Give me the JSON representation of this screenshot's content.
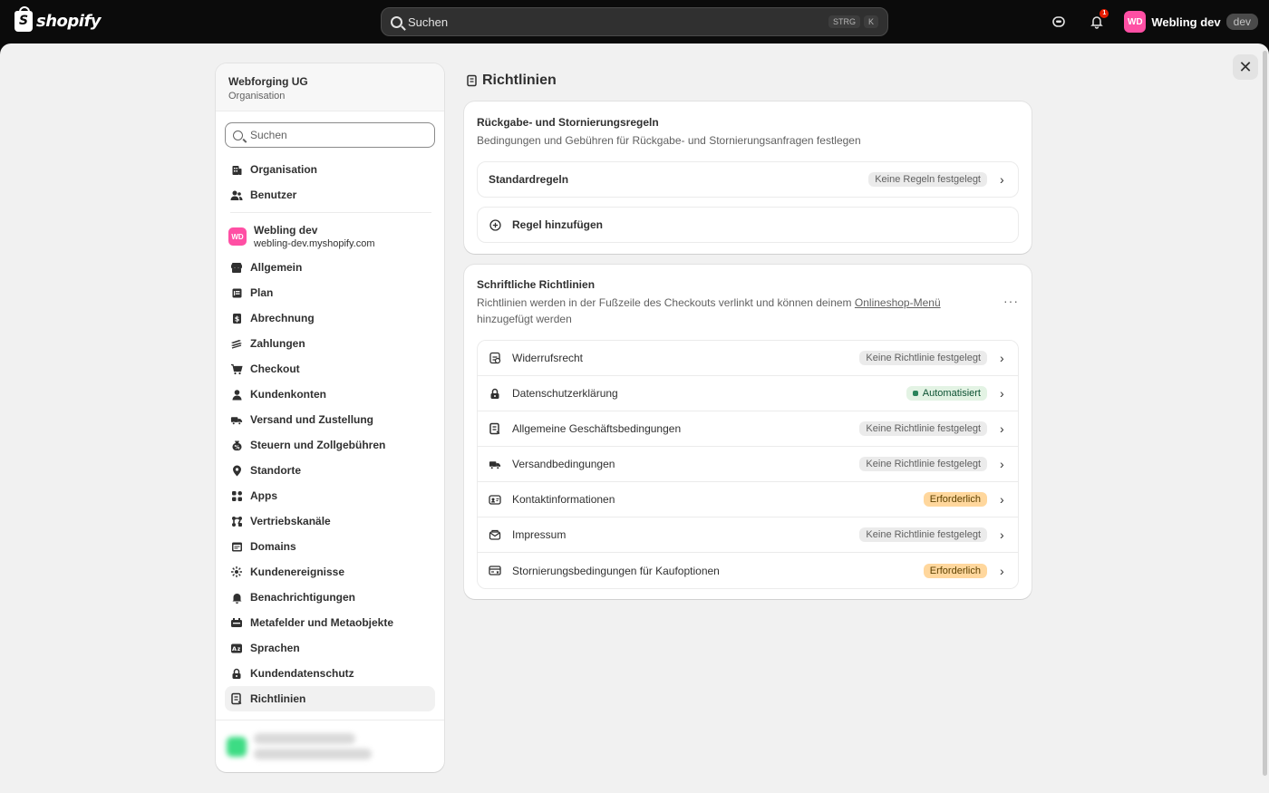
{
  "topbar": {
    "brand": "shopify",
    "search_placeholder": "Suchen",
    "shortcut_1": "STRG",
    "shortcut_2": "K",
    "notification_count": "1",
    "user_initials": "WD",
    "user_name": "Webling dev",
    "env_badge": "dev"
  },
  "sidebar": {
    "org_name": "Webforging UG",
    "org_sub": "Organisation",
    "search_placeholder": "Suchen",
    "org_items": [
      {
        "label": "Organisation",
        "icon": "building-icon"
      },
      {
        "label": "Benutzer",
        "icon": "users-icon"
      }
    ],
    "store_initials": "WD",
    "store_name": "Webling dev",
    "store_url": "webling-dev.myshopify.com",
    "items": [
      {
        "label": "Allgemein",
        "icon": "store-icon"
      },
      {
        "label": "Plan",
        "icon": "plan-icon"
      },
      {
        "label": "Abrechnung",
        "icon": "billing-icon"
      },
      {
        "label": "Zahlungen",
        "icon": "payments-icon"
      },
      {
        "label": "Checkout",
        "icon": "cart-icon"
      },
      {
        "label": "Kundenkonten",
        "icon": "person-icon"
      },
      {
        "label": "Versand und Zustellung",
        "icon": "truck-icon"
      },
      {
        "label": "Steuern und Zollgebühren",
        "icon": "tax-icon"
      },
      {
        "label": "Standorte",
        "icon": "location-icon"
      },
      {
        "label": "Apps",
        "icon": "apps-icon"
      },
      {
        "label": "Vertriebskanäle",
        "icon": "channels-icon"
      },
      {
        "label": "Domains",
        "icon": "domain-icon"
      },
      {
        "label": "Kundenereignisse",
        "icon": "events-icon"
      },
      {
        "label": "Benachrichtigungen",
        "icon": "bell-icon"
      },
      {
        "label": "Metafelder und Metaobjekte",
        "icon": "metafields-icon"
      },
      {
        "label": "Sprachen",
        "icon": "language-icon"
      },
      {
        "label": "Kundendatenschutz",
        "icon": "lock-icon"
      },
      {
        "label": "Richtlinien",
        "icon": "policy-icon"
      }
    ]
  },
  "main": {
    "title": "Richtlinien",
    "returns_card": {
      "title": "Rückgabe- und Stornierungsregeln",
      "desc": "Bedingungen und Gebühren für Rückgabe- und Stornierungsanfragen festlegen",
      "default_label": "Standardregeln",
      "default_badge": "Keine Regeln festgelegt",
      "add_label": "Regel hinzufügen"
    },
    "written_card": {
      "title": "Schriftliche Richtlinien",
      "desc_prefix": "Richtlinien werden in der Fußzeile des Checkouts verlinkt und können deinem ",
      "desc_link": "Onlineshop-Menü",
      "desc_suffix": " hinzugefügt werden",
      "rows": [
        {
          "label": "Widerrufsrecht",
          "badge": "Keine Richtlinie festgelegt",
          "badge_type": "neutral",
          "icon": "refund-icon"
        },
        {
          "label": "Datenschutzerklärung",
          "badge": "Automatisiert",
          "badge_type": "success",
          "icon": "lock-icon"
        },
        {
          "label": "Allgemeine Geschäftsbedingungen",
          "badge": "Keine Richtlinie festgelegt",
          "badge_type": "neutral",
          "icon": "policy-icon"
        },
        {
          "label": "Versandbedingungen",
          "badge": "Keine Richtlinie festgelegt",
          "badge_type": "neutral",
          "icon": "truck-icon"
        },
        {
          "label": "Kontaktinformationen",
          "badge": "Erforderlich",
          "badge_type": "attention",
          "icon": "contact-icon"
        },
        {
          "label": "Impressum",
          "badge": "Keine Richtlinie festgelegt",
          "badge_type": "neutral",
          "icon": "envelope-icon"
        },
        {
          "label": "Stornierungsbedingungen für Kaufoptionen",
          "badge": "Erforderlich",
          "badge_type": "attention",
          "icon": "card-icon"
        }
      ]
    }
  }
}
